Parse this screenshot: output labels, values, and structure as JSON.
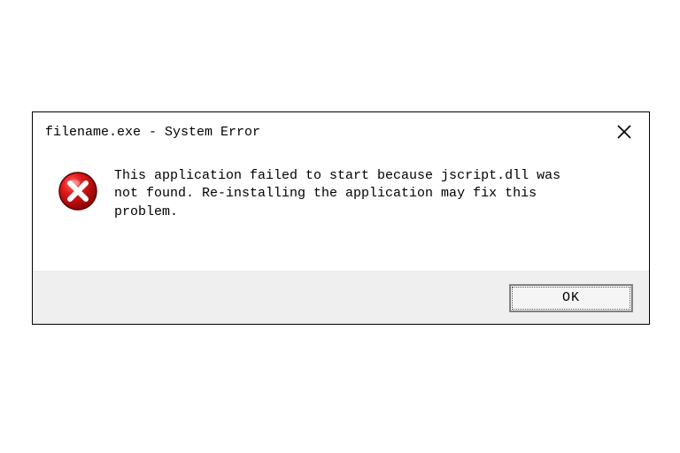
{
  "dialog": {
    "title": "filename.exe - System Error",
    "message": "This application failed to start because jscript.dll was not found. Re-installing the application may fix this problem.",
    "ok_label": "OK"
  }
}
